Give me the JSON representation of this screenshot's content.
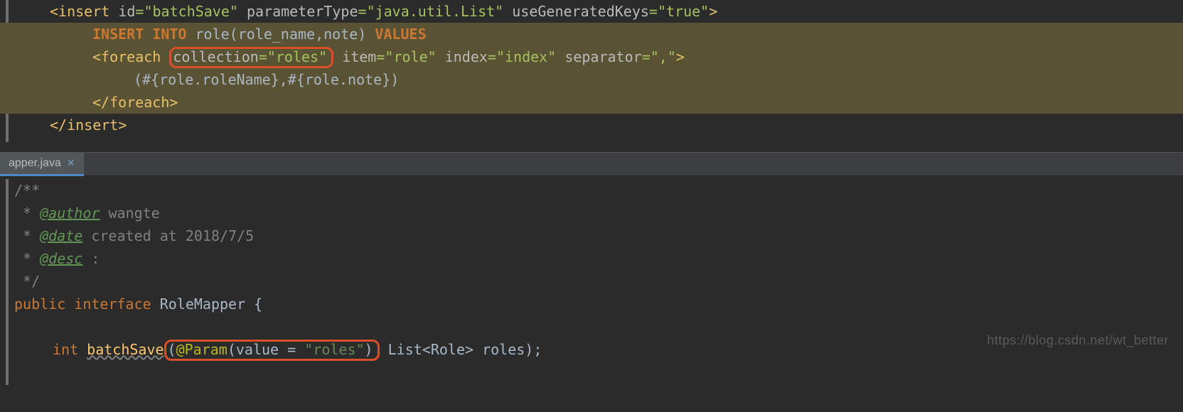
{
  "xml": {
    "insert_open_1": "<insert ",
    "insert_id_attr": "id",
    "insert_id_val": "\"batchSave\"",
    "insert_param_attr": "parameterType",
    "insert_param_val": "\"java.util.List\"",
    "insert_keys_attr": "useGeneratedKeys",
    "insert_keys_val": "\"true\"",
    "close_tag": ">",
    "sql_insert": "INSERT INTO",
    "sql_table": " role(role_name,note) ",
    "sql_values": "VALUES",
    "foreach_open": "<foreach ",
    "collection_attr": "collection",
    "collection_val": "\"roles\"",
    "item_attr": "item",
    "item_val": "\"role\"",
    "index_attr": "index",
    "index_val": "\"index\"",
    "separator_attr": "separator",
    "separator_val": "\",\"",
    "foreach_body": "(#{role.roleName},#{role.note})",
    "foreach_close": "</foreach>",
    "insert_close": "</insert>"
  },
  "tab": {
    "name": "apper.java"
  },
  "java": {
    "comment_open": "/**",
    "author_tag": "@author",
    "author_val": " wangte",
    "date_tag": "@date",
    "date_val": " created at 2018/7/5",
    "desc_tag": "@desc",
    "desc_val": " :",
    "comment_close": " */",
    "public": "public ",
    "interface": "interface ",
    "class_name": "RoleMapper ",
    "brace_open": "{",
    "method_type": "int ",
    "method_name": "batchSave",
    "paren_open": "(",
    "annotation": "@Param",
    "anno_paren_open": "(",
    "value_key": "value ",
    "equals": "= ",
    "value_str": "\"roles\"",
    "anno_paren_close": ")",
    "param_type": " List<Role> roles);",
    "star": " * "
  },
  "watermark": "https://blog.csdn.net/wt_better"
}
